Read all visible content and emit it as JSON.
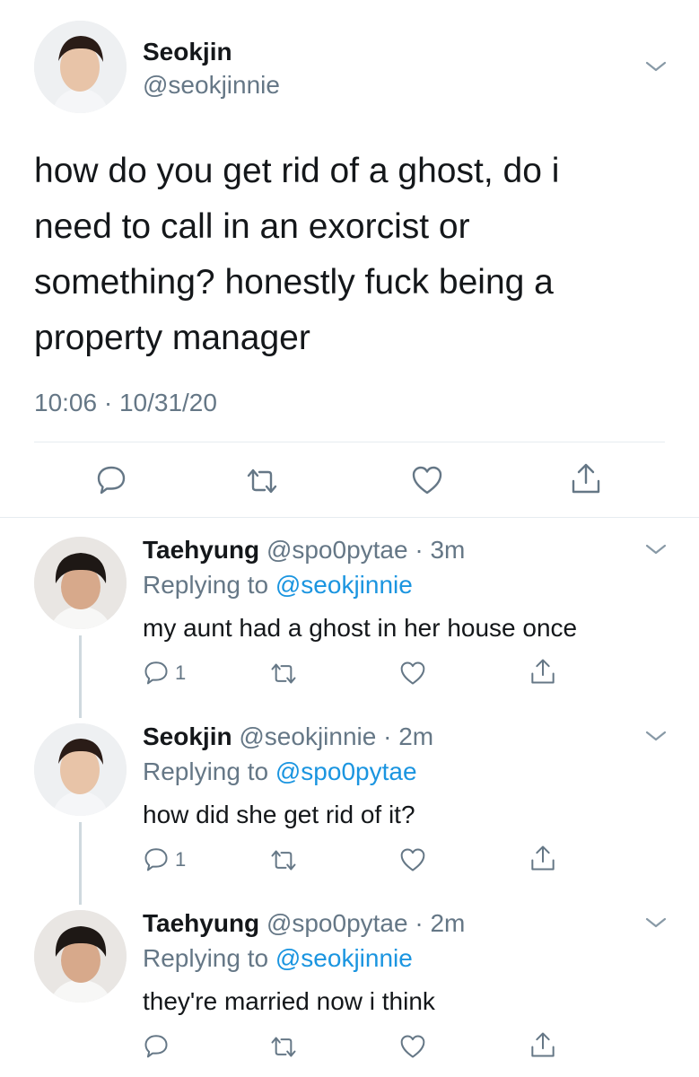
{
  "main_tweet": {
    "author_name": "Seokjin",
    "author_handle": "@seokjinnie",
    "text_lines": [
      "how do you get rid of a ghost, do i",
      "need to call in an exorcist or",
      "something? honestly fuck being a",
      "property manager"
    ],
    "timestamp": "10:06 · 10/31/20",
    "actions": [
      "reply-icon",
      "retweet-icon",
      "like-icon",
      "share-icon"
    ]
  },
  "replies": [
    {
      "name": "Taehyung",
      "meta": "@spo0pytae · 3m",
      "replying_prefix": "Replying to",
      "replying_to": "@seokjinnie",
      "text": "my aunt had a ghost in her house once",
      "reply_count": "1"
    },
    {
      "name": "Seokjin",
      "meta": "@seokjinnie · 2m",
      "replying_prefix": "Replying to",
      "replying_to": "@spo0pytae",
      "text": "how did she get rid of it?",
      "reply_count": "1"
    },
    {
      "name": "Taehyung",
      "meta": "@spo0pytae · 2m",
      "replying_prefix": "Replying to",
      "replying_to": "@seokjinnie",
      "text": "they're married now i think",
      "reply_count": ""
    }
  ],
  "colors": {
    "link": "#1b95e0",
    "muted": "#657786",
    "text": "#14171a",
    "divider": "#e6ecf0"
  }
}
